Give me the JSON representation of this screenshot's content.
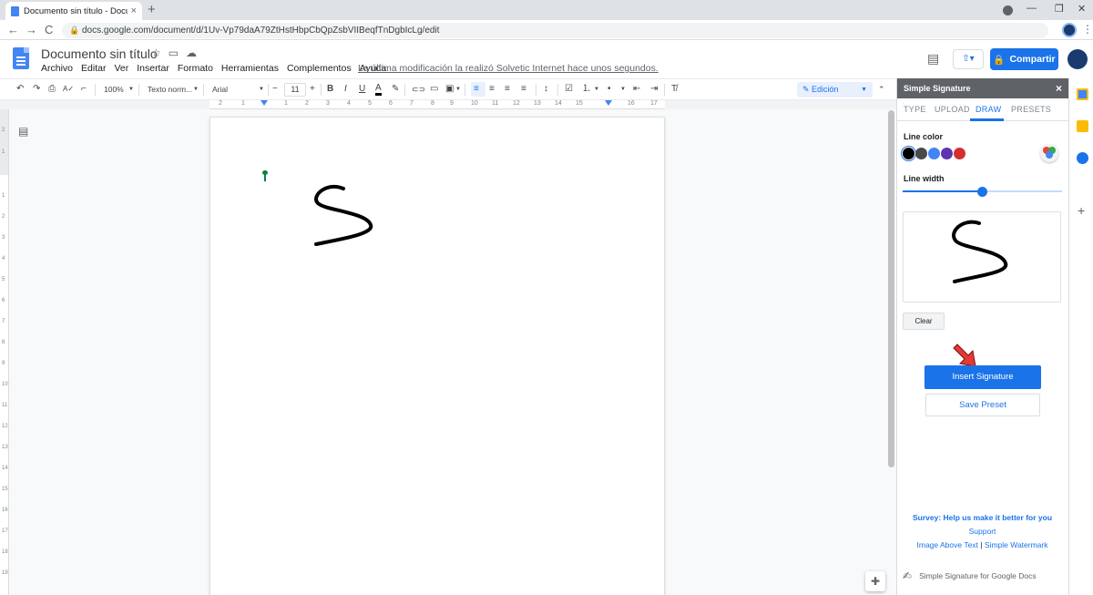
{
  "browser": {
    "tab_title": "Documento sin título - Docume",
    "tab_close": "×",
    "new_tab": "+",
    "url": "docs.google.com/document/d/1Uv-Vp79daA79ZtHstHbpCbQpZsbVIIBeqfTnDgbIcLg/edit",
    "nav_back": "←",
    "nav_forward": "→",
    "nav_reload": "C",
    "lock": "🔒",
    "menu": "⋮",
    "minimize": "—",
    "maximize": "❐",
    "close": "✕"
  },
  "docs": {
    "title": "Documento sin título",
    "menus": [
      "Archivo",
      "Editar",
      "Ver",
      "Insertar",
      "Formato",
      "Herramientas",
      "Complementos",
      "Ayuda"
    ],
    "last_edit": "La última modificación la realizó Solvetic Internet hace unos segundos.",
    "share_label": "Compartir",
    "share_icon": "lock-icon",
    "present_icon": "present-icon"
  },
  "toolbar": {
    "undo": "↶",
    "redo": "↷",
    "print": "⎙",
    "spell": "A✓",
    "paint": "⌐",
    "zoom": "100%",
    "style": "Texto norm...",
    "font": "Arial",
    "font_size": "11",
    "minus": "−",
    "plus": "+",
    "bold": "B",
    "italic": "I",
    "underline": "U",
    "text_color": "A",
    "highlight": "✎",
    "link": "🔗",
    "comment": "▭",
    "image": "▣",
    "align_left": "≡",
    "align_center": "≡",
    "align_right": "≡",
    "justify": "≡",
    "line_spacing": "↕",
    "checklist": "☑",
    "numbered": "⒈",
    "bulleted": "•",
    "indent_less": "⇤",
    "indent_more": "⇥",
    "clear_format": "T̸",
    "edit_mode": "Edición",
    "caret": "▼"
  },
  "ruler": {
    "h_numbers": [
      "2",
      "1",
      "1",
      "2",
      "3",
      "4",
      "5",
      "6",
      "7",
      "8",
      "9",
      "10",
      "11",
      "12",
      "13",
      "14",
      "15",
      "16",
      "17",
      "18"
    ],
    "v_numbers": [
      "2",
      "1",
      "1",
      "2",
      "3",
      "4",
      "5",
      "6",
      "7",
      "8",
      "9",
      "10",
      "11",
      "12",
      "13",
      "14",
      "15",
      "16",
      "17",
      "18",
      "19"
    ]
  },
  "panel": {
    "title": "Simple Signature",
    "close": "×",
    "tabs": [
      "TYPE",
      "UPLOAD",
      "DRAW",
      "PRESETS"
    ],
    "active_tab": "DRAW",
    "line_color_label": "Line color",
    "line_width_label": "Line width",
    "line_width_fraction": 0.5,
    "colors": [
      "#000000",
      "#4a4a4a",
      "#4285f4",
      "#5e35b1",
      "#d32f2f"
    ],
    "selected_color": "#000000",
    "clear_label": "Clear",
    "insert_label": "Insert Signature",
    "save_preset_label": "Save Preset",
    "survey": "Survey: Help us make it better for you",
    "support": "Support",
    "link_image_above": "Image Above Text",
    "link_sep": "|",
    "link_watermark": "Simple Watermark",
    "footer": "Simple Signature for Google Docs"
  },
  "colors": {
    "accent": "#1a73e8",
    "arrow": "#e53935"
  }
}
